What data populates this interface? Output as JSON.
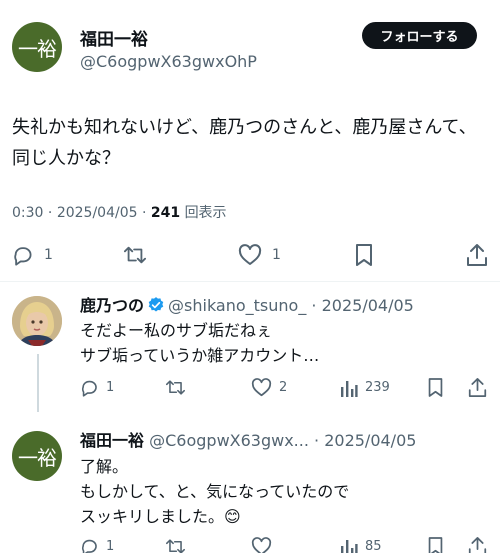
{
  "main_post": {
    "avatar_text": "一裕",
    "name": "福田一裕",
    "handle": "@C6ogpwX63gwxOhP",
    "follow_label": "フォローする",
    "text": "失礼かも知れないけど、鹿乃つのさんと、鹿乃屋さんて、同じ人かな？",
    "time": "0:30",
    "date": "2025/04/05",
    "views_count": "241",
    "views_label": "回表示",
    "actions": {
      "reply_count": "1",
      "like_count": "1"
    }
  },
  "replies": [
    {
      "name": "鹿乃つの",
      "verified": true,
      "handle": "@shikano_tsuno_",
      "date": "2025/04/05",
      "text": "そだよー私のサブ垢だねぇ\nサブ垢っていうか雑アカウント…",
      "reply_count": "1",
      "like_count": "2",
      "views_count": "239"
    },
    {
      "avatar_text": "一裕",
      "name": "福田一裕",
      "handle": "@C6ogpwX63gwx...",
      "date": "2025/04/05",
      "text": "了解。\nもしかして、と、気になっていたので\nスッキリしました。😊",
      "reply_count": "1",
      "views_count": "85"
    }
  ],
  "colors": {
    "avatar_green": "#4a6b2a",
    "verified_blue": "#1d9bf0",
    "muted": "#536471",
    "thread_line": "#cfd9de"
  }
}
